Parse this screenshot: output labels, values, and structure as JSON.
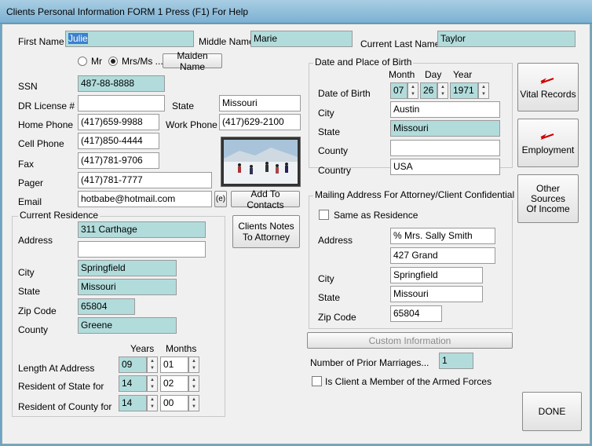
{
  "window": {
    "title": "Clients Personal Information  FORM 1   Press (F1) For Help"
  },
  "name": {
    "first_label": "First Name",
    "first": "Julie",
    "middle_label": "Middle Name",
    "middle": "Marie",
    "last_label": "Current Last Name",
    "last": "Taylor"
  },
  "salutation": {
    "mr": "Mr",
    "mrs": "Mrs/Ms ...",
    "selected": "Mrs/Ms ...",
    "maiden_button": "Maiden Name"
  },
  "personal": {
    "ssn_label": "SSN",
    "ssn": "487-88-8888",
    "dl_label": "DR License #",
    "dl": "",
    "state_label": "State",
    "state": "Missouri",
    "home_label": "Home Phone",
    "home": "(417)659-9988",
    "work_label": "Work Phone",
    "work": "(417)629-2100",
    "cell_label": "Cell Phone",
    "cell": "(417)850-4444",
    "fax_label": "Fax",
    "fax": "(417)781-9706",
    "pager_label": "Pager",
    "pager": "(417)781-7777",
    "email_label": "Email",
    "email": "hotbabe@hotmail.com",
    "email_btn": "(e)",
    "add_contacts": "Add To Contacts"
  },
  "residence": {
    "group_title": "Current Residence",
    "address_label": "Address",
    "address1": "311 Carthage",
    "address2": "",
    "city_label": "City",
    "city": "Springfield",
    "state_label": "State",
    "state": "Missouri",
    "zip_label": "Zip Code",
    "zip": "65804",
    "county_label": "County",
    "county": "Greene",
    "years_label": "Years",
    "months_label": "Months",
    "length_label": "Length At Address",
    "length_years": "09",
    "length_months": "01",
    "state_res_label": "Resident of State for",
    "state_years": "14",
    "state_months": "02",
    "county_res_label": "Resident of County for",
    "county_years": "14",
    "county_months": "00"
  },
  "notes_button": {
    "line1": "Clients Notes",
    "line2": "To Attorney"
  },
  "birth": {
    "group_title": "Date and Place of Birth",
    "month_label": "Month",
    "day_label": "Day",
    "year_label": "Year",
    "dob_label": "Date of Birth",
    "month": "07",
    "day": "26",
    "year": "1971",
    "city_label": "City",
    "city": "Austin",
    "state_label": "State",
    "state": "Missouri",
    "county_label": "County",
    "county": "",
    "country_label": "Country",
    "country": "USA"
  },
  "mailing": {
    "group_title": "Mailing Address For Attorney/Client Confidential Mail",
    "same_label": "Same as Residence",
    "address_label": "Address",
    "address1": "% Mrs. Sally Smith",
    "address2": "427 Grand",
    "city_label": "City",
    "city": "Springfield",
    "state_label": "State",
    "state": "Missouri",
    "zip_label": "Zip Code",
    "zip": "65804"
  },
  "custom_button": "Custom Information",
  "marriages": {
    "label": "Number of Prior Marriages...",
    "value": "1"
  },
  "armed_forces": {
    "label": "Is Client a Member of the Armed Forces"
  },
  "side_buttons": {
    "vital": "Vital Records",
    "employment": "Employment",
    "other1": "Other",
    "other2": "Sources",
    "other3": "Of Income"
  },
  "done": "DONE",
  "colors": {
    "field_teal": "#b2dcdc",
    "selection": "#3a7fd0",
    "titlebar": "#7cb1d3"
  }
}
